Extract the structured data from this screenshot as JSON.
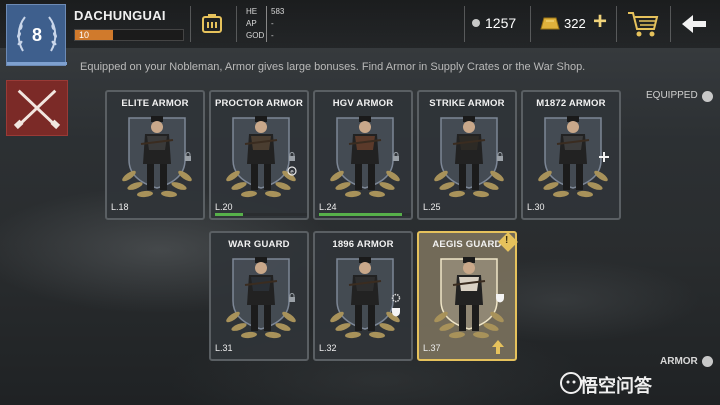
{
  "player": {
    "name": "DACHUNGUAI",
    "rank": "8",
    "level": "10",
    "xp_fraction": 0.35
  },
  "stats": [
    {
      "label": "HE",
      "value": "583"
    },
    {
      "label": "AP",
      "value": "-"
    },
    {
      "label": "GOD",
      "value": "-"
    }
  ],
  "currency": {
    "silver": "1257",
    "gold": "322"
  },
  "subtitle": "Equipped on your Nobleman, Armor gives large bonuses. Find Armor in Supply Crates or the War Shop.",
  "toggles": {
    "equipped_label": "EQUIPPED",
    "armor_label": "ARMOR"
  },
  "cards": [
    {
      "name": "ELITE ARMOR",
      "level": "L.18",
      "progress": 0
    },
    {
      "name": "PROCTOR ARMOR",
      "level": "L.20",
      "progress": 0.3
    },
    {
      "name": "HGV ARMOR",
      "level": "L.24",
      "progress": 0.9
    },
    {
      "name": "STRIKE ARMOR",
      "level": "L.25",
      "progress": 0
    },
    {
      "name": "M1872 ARMOR",
      "level": "L.30",
      "progress": 0
    },
    {
      "name": "WAR GUARD",
      "level": "L.31",
      "progress": 0
    },
    {
      "name": "1896 ARMOR",
      "level": "L.32",
      "progress": 0
    },
    {
      "name": "AEGIS GUARD",
      "level": "L.37",
      "progress": 0,
      "selected": true
    }
  ],
  "watermark": {
    "text": "悟空问答"
  },
  "icons": {
    "rank": "laurel-wreath-icon",
    "ticket": "ticket-icon",
    "gold": "gold-bar-icon",
    "cart": "shopping-cart-icon",
    "back": "back-arrow-icon",
    "class": "crossed-rifles-icon"
  },
  "colors": {
    "accent_gold": "#e6c25c",
    "xp_orange": "#d07a2c",
    "progress_green": "#57b04a",
    "rank_blue": "#3e5f8d"
  }
}
